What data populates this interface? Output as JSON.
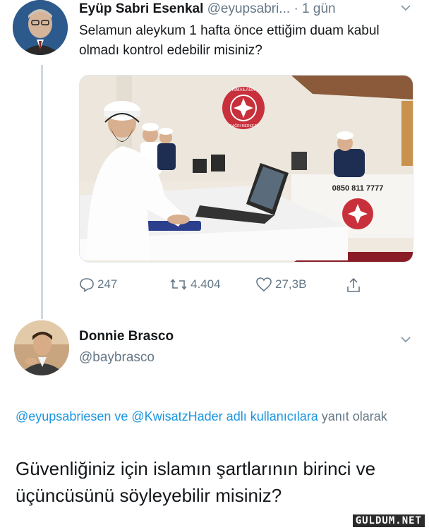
{
  "tweet1": {
    "name": "Eyüp Sabri Esenkal",
    "handle": "@eyupsabri...",
    "time": "· 1 gün",
    "text": "Selamun aleykum 1 hafta önce ettiğim duam kabul olmadı kontrol edebilir misiniz?",
    "photo": {
      "desk_sign_text": "0850 811 7777",
      "logo_text": "İSMAİLAĞA",
      "logo_subtext": "ÇAĞRI MERKEZİ"
    },
    "actions": {
      "replies": "247",
      "retweets": "4.404",
      "likes": "27,3B"
    }
  },
  "tweet2": {
    "name": "Donnie Brasco",
    "handle": "@baybrasco",
    "reply_prefix_link": "@eyupsabriesen ve @KwisatzHader adlı kullanıcılara",
    "reply_suffix": " yanıt olarak",
    "text": "Güvenliğiniz için islamın şartlarının birinci ve üçüncüsünü söyleyebilir misiniz?"
  },
  "watermark": "GULDUM.NET",
  "icons": [
    "chevron-down-icon",
    "reply-icon",
    "retweet-icon",
    "like-icon",
    "share-icon"
  ],
  "colors": {
    "link": "#1b95e0",
    "muted": "#657786"
  }
}
